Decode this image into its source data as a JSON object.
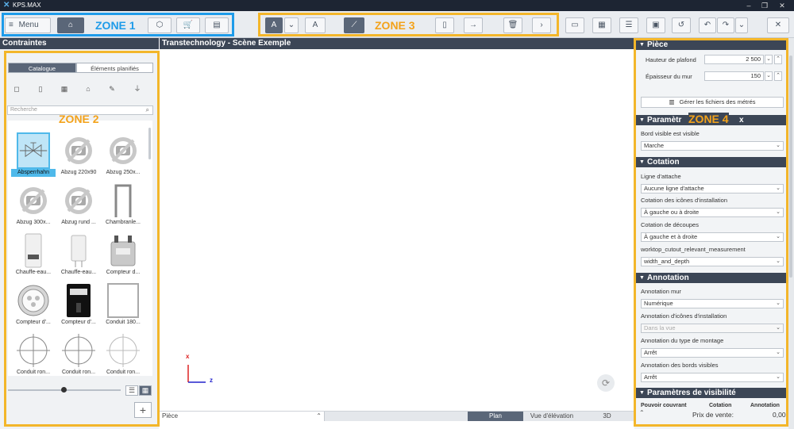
{
  "window": {
    "title": "KPS.MAX"
  },
  "toolbar": {
    "menu_label": "Menu",
    "zone1_label": "ZONE 1",
    "zone3_label": "ZONE 3"
  },
  "left_panel": {
    "title": "Contraintes",
    "zone_label": "ZONE 2",
    "tabs": [
      {
        "label": "Catalogue",
        "active": true
      },
      {
        "label": "Éléments planifiés",
        "active": false
      }
    ],
    "search_placeholder": "Recherche",
    "items": [
      {
        "label": "Absperrhahn",
        "icon": "valve-icon",
        "selected": true
      },
      {
        "label": "Abzug 220x90",
        "icon": "no-image-icon"
      },
      {
        "label": "Abzug 250x...",
        "icon": "no-image-icon"
      },
      {
        "label": "Abzug 300x...",
        "icon": "no-image-icon"
      },
      {
        "label": "Abzug rund ...",
        "icon": "no-image-icon"
      },
      {
        "label": "Chambranle...",
        "icon": "door-frame-icon"
      },
      {
        "label": "Chauffe-eau...",
        "icon": "water-heater-icon"
      },
      {
        "label": "Chauffe-eau...",
        "icon": "water-heater-icon"
      },
      {
        "label": "Compteur d...",
        "icon": "gas-meter-icon"
      },
      {
        "label": "Compteur d'...",
        "icon": "dial-meter-icon"
      },
      {
        "label": "Compteur d'...",
        "icon": "electric-meter-icon"
      },
      {
        "label": "Conduit 180...",
        "icon": "duct-icon"
      },
      {
        "label": "Conduit ron...",
        "icon": "round-duct-icon"
      },
      {
        "label": "Conduit ron...",
        "icon": "round-duct-icon"
      },
      {
        "label": "Conduit ron...",
        "icon": "round-duct-icon"
      }
    ]
  },
  "canvas": {
    "title": "Transtechnology - Scène Exemple",
    "axis_x": "x",
    "axis_z": "z",
    "status_field": "Pièce",
    "views": [
      {
        "label": "Plan",
        "active": true
      },
      {
        "label": "Vue d'élévation",
        "active": false
      },
      {
        "label": "3D",
        "active": false
      }
    ]
  },
  "right_panel": {
    "zone_label": "ZONE 4",
    "sections": {
      "piece": "Pièce",
      "parametres_prefix": "Paramètr",
      "parametres_suffix": "x",
      "cotation": "Cotation",
      "annotation": "Annotation",
      "visibilite": "Paramètres de visibilité"
    },
    "ceiling_label": "Hauteur de plafond",
    "ceiling_value": "2 500",
    "wall_label": "Épaisseur du mur",
    "wall_value": "150",
    "manage_button": "Gérer les fichiers des métrés",
    "bord_label": "Bord visible est visible",
    "bord_value": "Marche",
    "ligne_label": "Ligne d'attache",
    "ligne_value": "Aucune ligne d'attache",
    "cot_icons_label": "Cotation des icônes d'installation",
    "cot_icons_value": "À gauche ou à droite",
    "cot_decoupes_label": "Cotation de découpes",
    "cot_decoupes_value": "À gauche et à droite",
    "worktop_label": "worktop_cutout_relevant_measurement",
    "worktop_value": "width_and_depth",
    "ann_mur_label": "Annotation mur",
    "ann_mur_value": "Numérique",
    "ann_icons_label": "Annotation d'icônes d'installation",
    "ann_icons_value": "Dans la vue",
    "ann_montage_label": "Annotation du type de montage",
    "ann_montage_value": "Arrêt",
    "ann_bords_label": "Annotation des bords visibles",
    "ann_bords_value": "Arrêt",
    "vis_col1": "Pouvoir couvrant",
    "vis_col2": "Cotation",
    "vis_col3": "Annotation",
    "price_label": "Prix de vente:",
    "price_value": "0,00"
  }
}
